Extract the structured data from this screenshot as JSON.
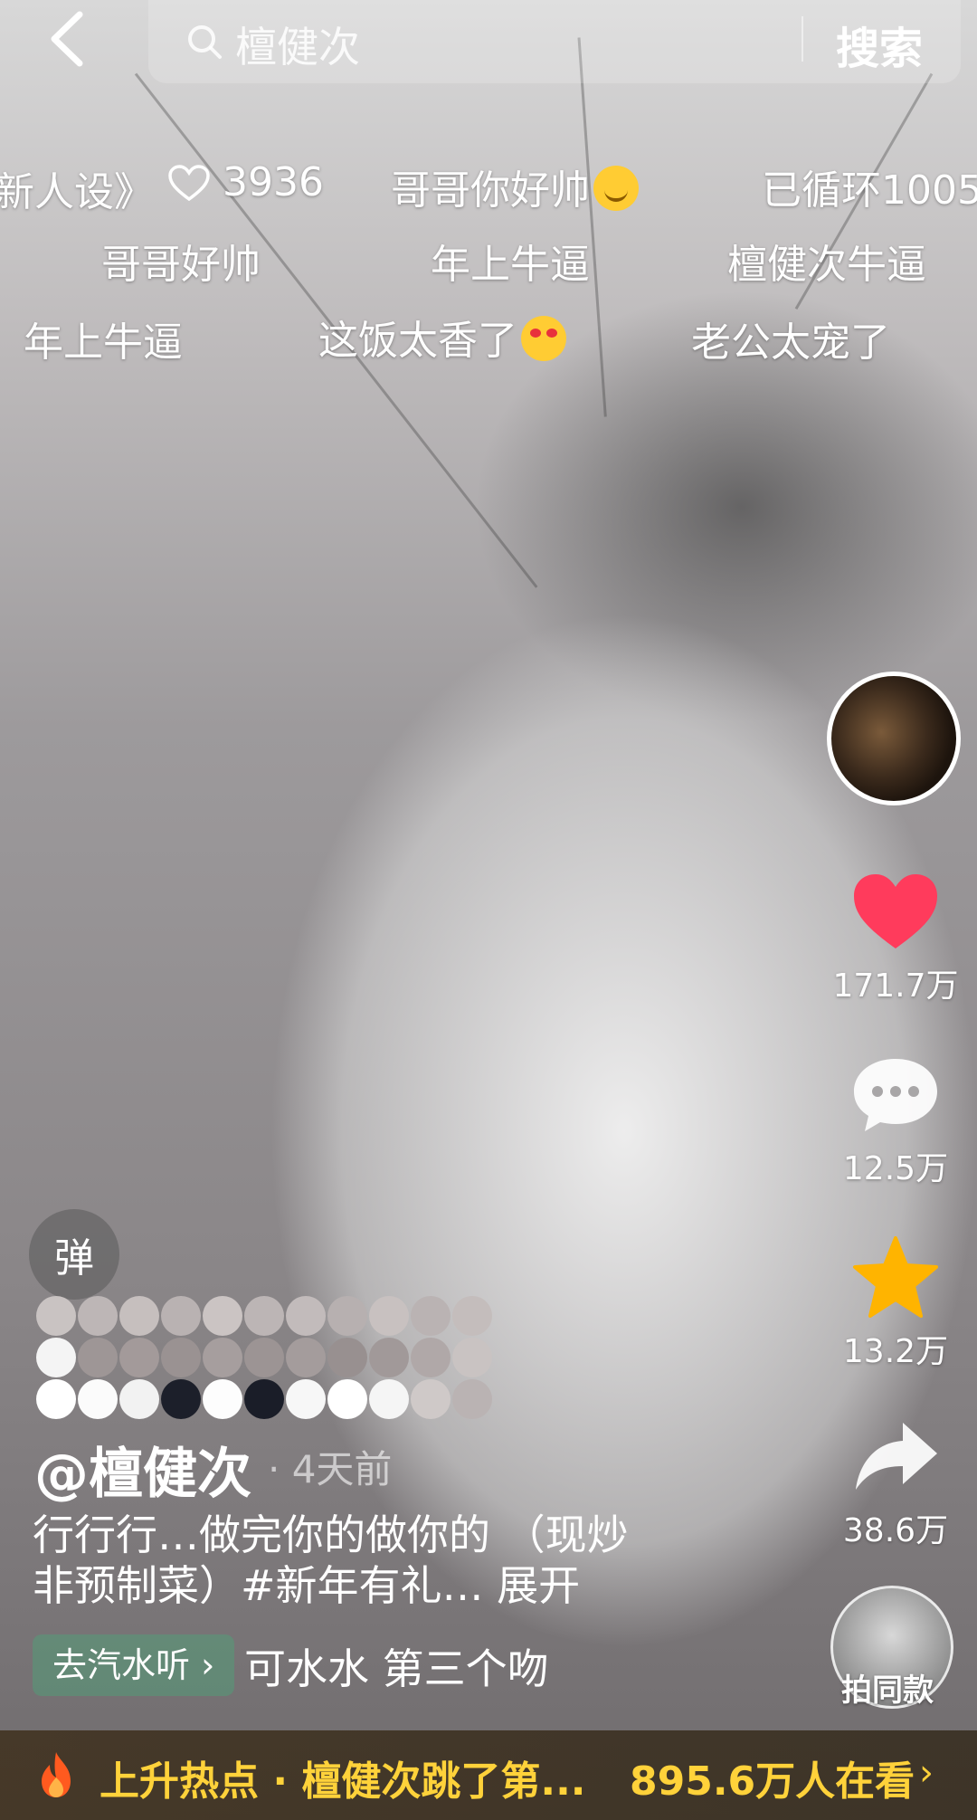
{
  "search": {
    "query": "檀健次",
    "button_label": "搜索"
  },
  "danmaku": {
    "row1": [
      "新人设》",
      "3936",
      "哥哥你好帅",
      "已循环1005"
    ],
    "row2": [
      "哥哥好帅",
      "年上牛逼",
      "檀健次牛逼"
    ],
    "row3": [
      "年上牛逼",
      "这饭太香了",
      "老公太宠了"
    ]
  },
  "rail": {
    "likes": "171.7万",
    "comments": "12.5万",
    "favorites": "13.2万",
    "shares": "38.6万"
  },
  "video": {
    "danmu_toggle": "弹",
    "author": "@檀健次",
    "time": "· 4天前",
    "desc_line1": "行行行…做完你的做你的 （现炒",
    "desc_line2": "非预制菜）#新年有礼… 展开",
    "music_button": "去汽水听 ›",
    "music_text": "可水水    第三个吻",
    "same_style": "拍同款"
  },
  "hot": {
    "label": "上升热点 · 檀健次跳了第...",
    "count": "895.6万人在看",
    "chevron": "›"
  },
  "colors": {
    "like": "#ff3b5c",
    "favorite": "#ffb400",
    "hot_text": "#ffd23a"
  }
}
